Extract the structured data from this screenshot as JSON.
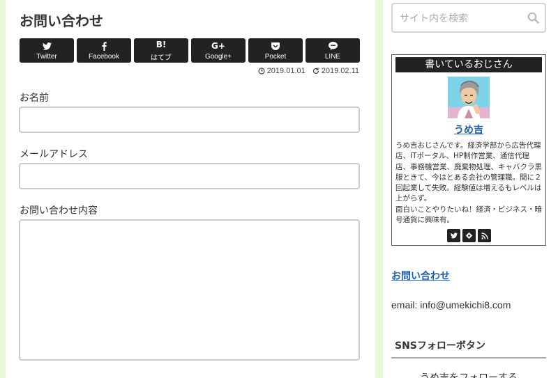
{
  "page": {
    "title": "お問い合わせ"
  },
  "share_buttons": [
    {
      "label": "Twitter",
      "icon": "twitter-icon"
    },
    {
      "label": "Facebook",
      "icon": "facebook-icon"
    },
    {
      "label": "はてブ",
      "icon": "hatena-bookmark-icon",
      "icon_text": "B!"
    },
    {
      "label": "Google+",
      "icon": "google-plus-icon",
      "icon_text": "G+"
    },
    {
      "label": "Pocket",
      "icon": "pocket-icon"
    },
    {
      "label": "LINE",
      "icon": "line-icon"
    }
  ],
  "dates": {
    "published": "2019.01.01",
    "updated": "2019.02.11"
  },
  "form": {
    "name_label": "お名前",
    "name_value": "",
    "email_label": "メールアドレス",
    "email_value": "",
    "message_label": "お問い合わせ内容",
    "message_value": ""
  },
  "sidebar": {
    "search_placeholder": "サイト内を検索",
    "profile": {
      "header": "書いているおじさん",
      "name": "うめ吉",
      "description_lines": [
        "うめ吉おじさんです。経済学部から広告代理店、ITポータル、HP制作営業、通信代理店、事務機営業、廃棄物処理、キャバクラ黒服ときて、今はとある会社の管理職。間に２回起業して失敗。経験値は増えるもレベルは上がらず。",
        "面白いことやりたいね！経済・ビジネス・暗号通貨に興味有。"
      ],
      "icons": [
        "twitter-icon",
        "feedly-icon",
        "rss-icon"
      ]
    },
    "contact_link": "お問い合わせ",
    "email": "email: info@umekichi8.com",
    "sns_title": "SNSフォローボタン",
    "sns_follow_text": "うめ吉をフォローする"
  },
  "colors": {
    "background": "#e9f8d6",
    "button_dark": "#222222",
    "link_blue": "#1a5fb4"
  }
}
